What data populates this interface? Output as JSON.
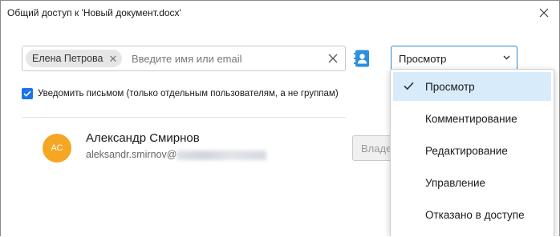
{
  "window": {
    "title": "Общий доступ к 'Новый документ.docx'"
  },
  "invite": {
    "chip_label": "Елена Петрова",
    "chip_remove": "✕",
    "placeholder": "Введите имя или email"
  },
  "role_select": {
    "value": "Просмотр"
  },
  "notify": {
    "checked": true,
    "label": "Уведомить письмом (только отдельным пользователям, а не группам)"
  },
  "user": {
    "initials": "АС",
    "name": "Александр Смирнов",
    "email_visible": "aleksandr.smirnov@",
    "role_button": "Владелец"
  },
  "dropdown": {
    "items": [
      {
        "label": "Просмотр",
        "selected": true
      },
      {
        "label": "Комментирование",
        "selected": false
      },
      {
        "label": "Редактирование",
        "selected": false
      },
      {
        "label": "Управление",
        "selected": false
      },
      {
        "label": "Отказано в доступе",
        "selected": false
      }
    ]
  },
  "colors": {
    "accent": "#1a73e8",
    "select_border": "#2b89d0",
    "selected_item_bg": "#d7ebfa",
    "avatar_bg": "#f5a623",
    "contacts_icon": "#2d8fde"
  },
  "icons": {
    "close": "close-icon",
    "clear": "clear-icon",
    "contacts": "address-book-icon",
    "chevron": "chevron-down-icon",
    "check": "checkmark-icon"
  }
}
